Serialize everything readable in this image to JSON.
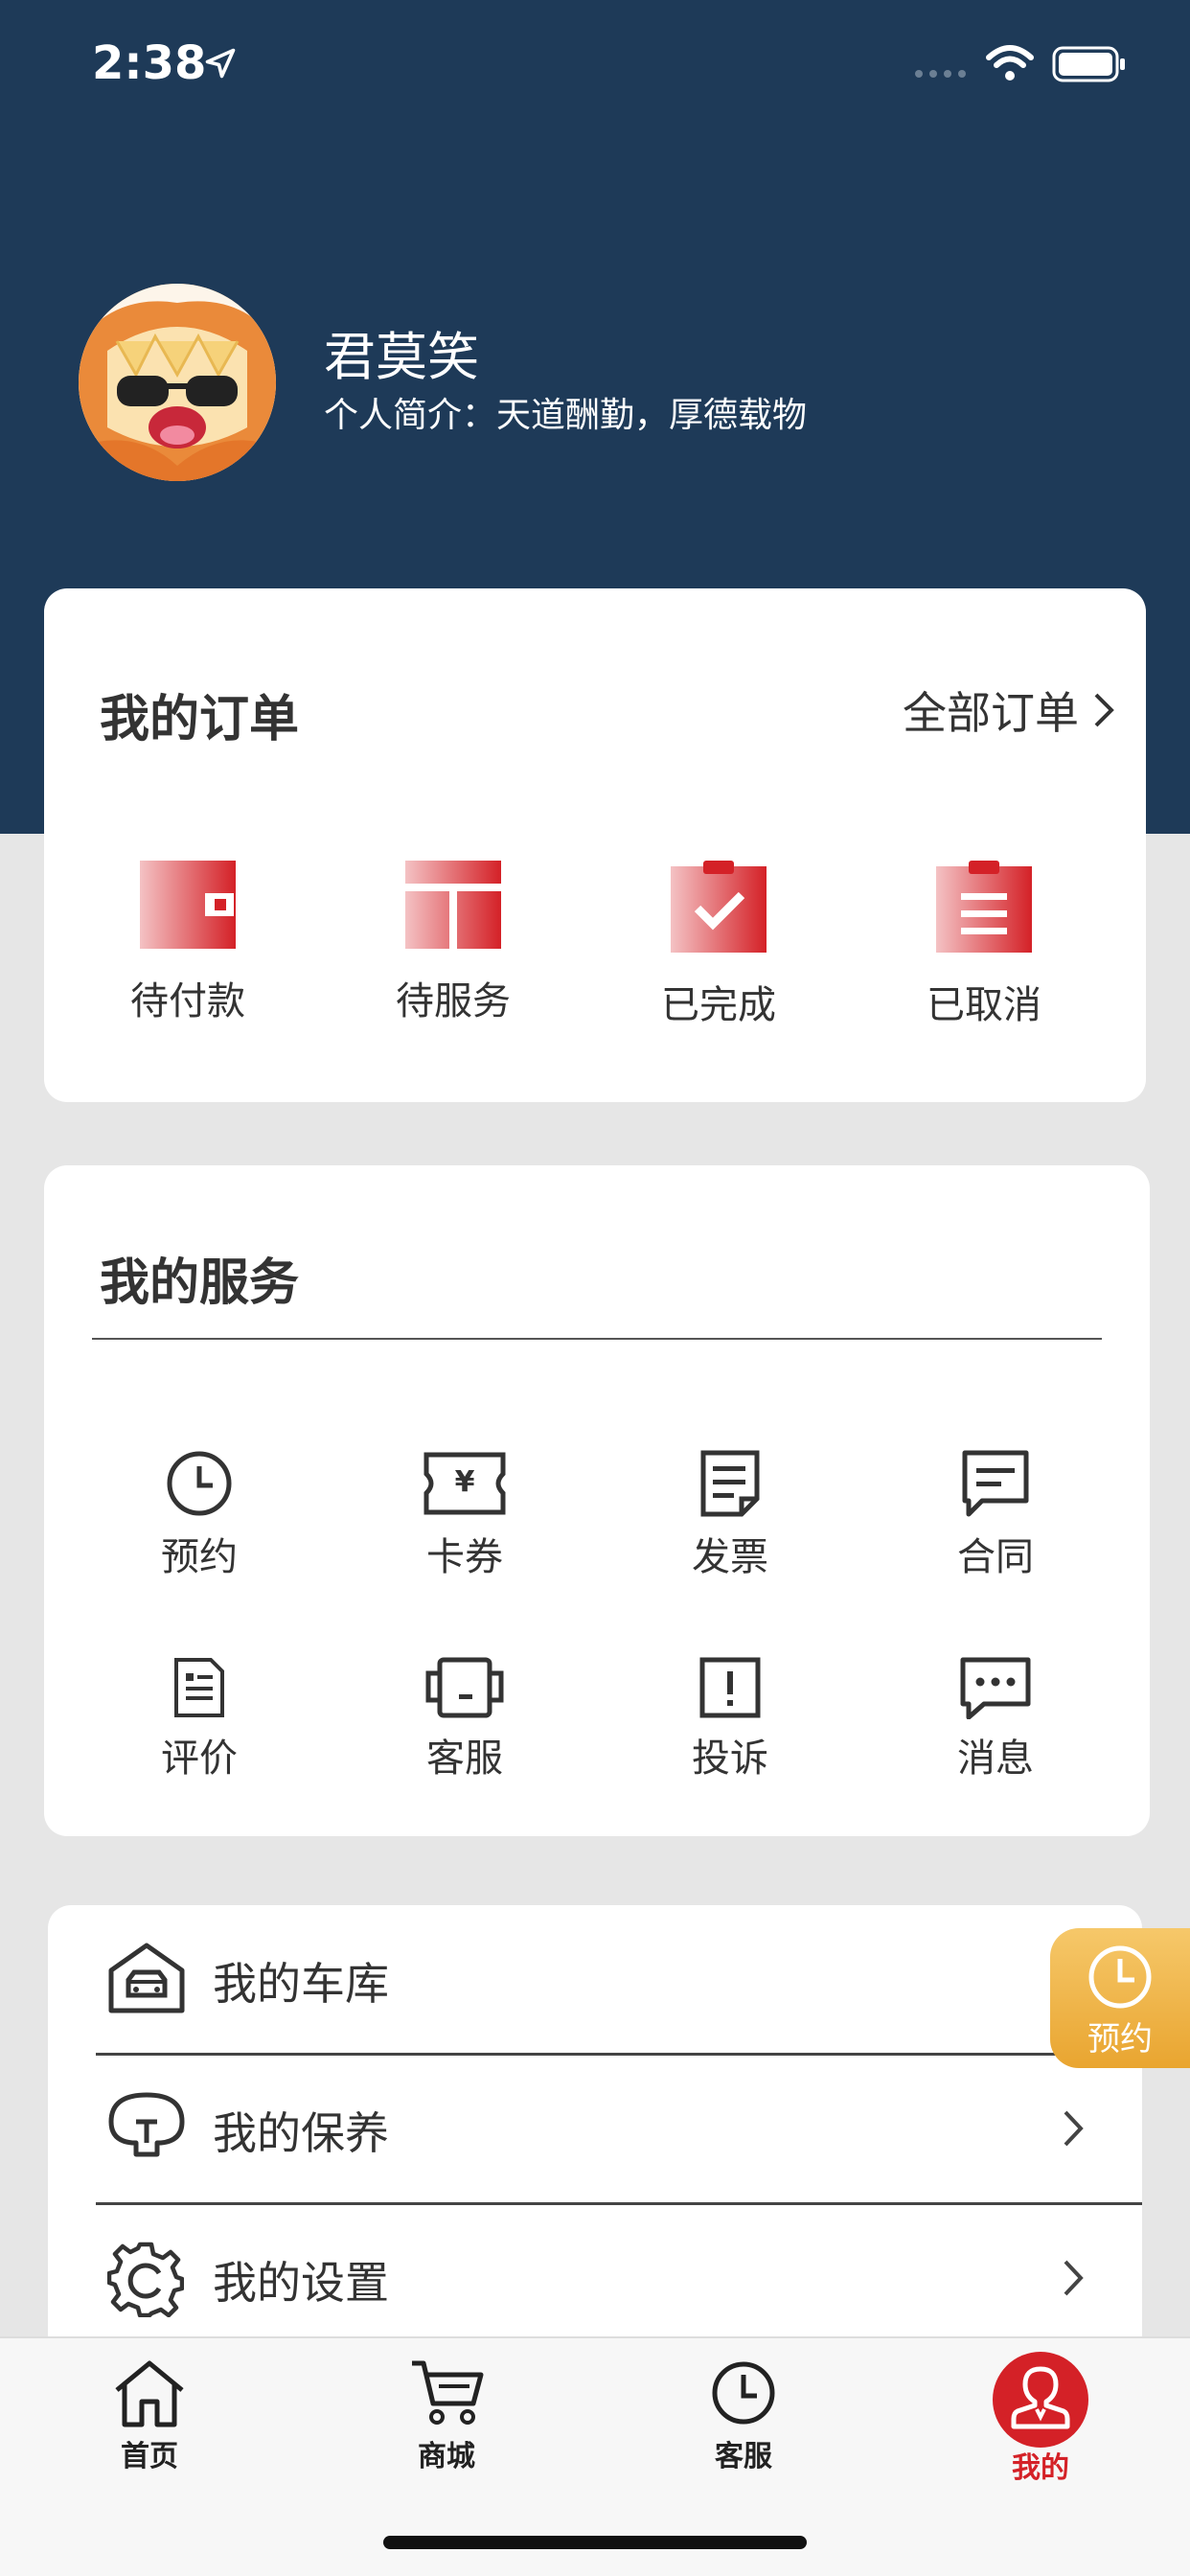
{
  "status_bar": {
    "time": "2:38"
  },
  "profile": {
    "name": "君莫笑",
    "bio": "个人简介：天道酬勤，厚德载物"
  },
  "orders": {
    "title": "我的订单",
    "all_label": "全部订单",
    "items": [
      {
        "label": "待付款",
        "icon": "wallet-icon"
      },
      {
        "label": "待服务",
        "icon": "service-pending-icon"
      },
      {
        "label": "已完成",
        "icon": "clipboard-check-icon"
      },
      {
        "label": "已取消",
        "icon": "clipboard-list-icon"
      }
    ]
  },
  "services": {
    "title": "我的服务",
    "items": [
      {
        "label": "预约",
        "icon": "clock-icon"
      },
      {
        "label": "卡券",
        "icon": "coupon-icon"
      },
      {
        "label": "发票",
        "icon": "invoice-icon"
      },
      {
        "label": "合同",
        "icon": "contract-icon"
      },
      {
        "label": "评价",
        "icon": "review-icon"
      },
      {
        "label": "客服",
        "icon": "customer-service-icon"
      },
      {
        "label": "投诉",
        "icon": "complaint-icon"
      },
      {
        "label": "消息",
        "icon": "message-icon"
      }
    ]
  },
  "menu": {
    "items": [
      {
        "label": "我的车库",
        "icon": "garage-icon"
      },
      {
        "label": "我的保养",
        "icon": "maintenance-icon"
      },
      {
        "label": "我的设置",
        "icon": "settings-gear-icon"
      }
    ]
  },
  "floating_button": {
    "label": "预约"
  },
  "tabbar": {
    "items": [
      {
        "label": "首页",
        "icon": "home-icon"
      },
      {
        "label": "商城",
        "icon": "cart-icon"
      },
      {
        "label": "客服",
        "icon": "clock-icon"
      },
      {
        "label": "我的",
        "icon": "user-icon"
      }
    ],
    "active_index": 3
  },
  "colors": {
    "header": "#1e3a58",
    "accent_red": "#d42127",
    "float_orange": "#eeb04a"
  }
}
